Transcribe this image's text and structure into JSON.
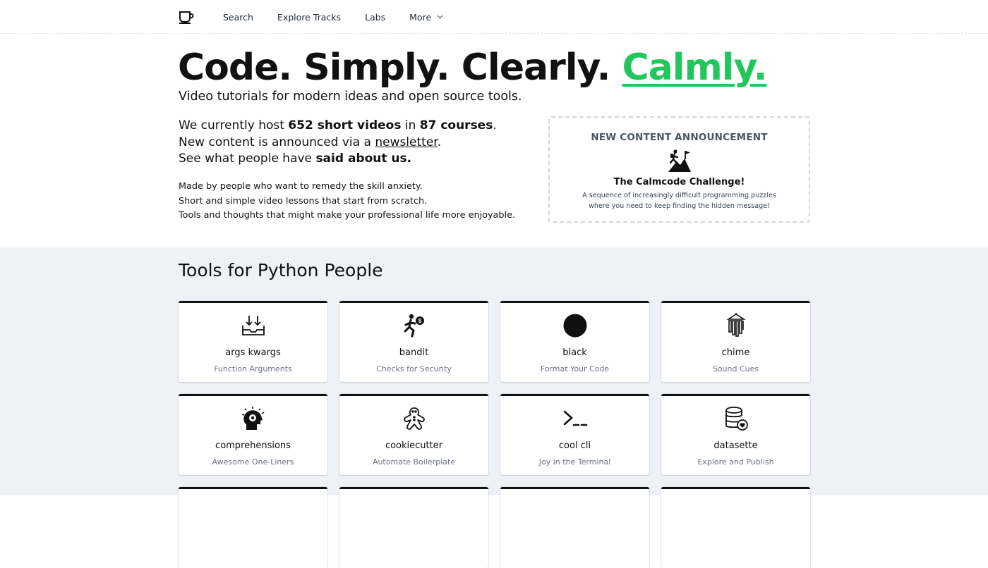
{
  "nav": {
    "logo_icon": "teacup-icon",
    "links": [
      "Search",
      "Explore Tracks",
      "Labs"
    ],
    "more_label": "More"
  },
  "hero": {
    "title_main": "Code. Simply. Clearly.",
    "title_accent": "Calmly.",
    "accent_color": "#22c55e",
    "subtitle": "Video tutorials for modern ideas and open source tools."
  },
  "stats": {
    "line1_prefix": "We currently host",
    "videos": "652 short videos",
    "line1_mid": "in",
    "courses": "87 courses",
    "line1_end": ".",
    "line2_prefix": "New content is announced via a",
    "newsletter": "newsletter",
    "line2_end": ".",
    "line3_prefix": "See what people have",
    "said_about": "said about us."
  },
  "mission": [
    "Made by people who want to remedy the skill anxiety.",
    "Short and simple video lessons that start from scratch.",
    "Tools and thoughts that might make your professional life more enjoyable."
  ],
  "announcement": {
    "heading": "NEW CONTENT ANNOUNCEMENT",
    "icon": "mountain-climber-flag-icon",
    "title": "The Calmcode Challenge!",
    "desc_line1": "A sequence of increasingly difficult programming puzzles",
    "desc_line2": "where you need to keep finding the hidden message!"
  },
  "tools": {
    "title": "Tools for Python People",
    "cards": [
      {
        "name": "args kwargs",
        "desc": "Function Arguments",
        "icon": "inbox-arrows-icon"
      },
      {
        "name": "bandit",
        "desc": "Checks for Security",
        "icon": "running-thief-icon"
      },
      {
        "name": "black",
        "desc": "Format Your Code",
        "icon": "black-circle-icon"
      },
      {
        "name": "chime",
        "desc": "Sound Cues",
        "icon": "chimes-icon"
      },
      {
        "name": "comprehensions",
        "desc": "Awesome One-Liners",
        "icon": "head-gear-icon"
      },
      {
        "name": "cookiecutter",
        "desc": "Automate Boilerplate",
        "icon": "gingerbread-icon"
      },
      {
        "name": "cool cli",
        "desc": "Joy in the Terminal",
        "icon": "terminal-prompt-icon"
      },
      {
        "name": "datasette",
        "desc": "Explore and Publish",
        "icon": "database-heart-icon"
      }
    ]
  }
}
